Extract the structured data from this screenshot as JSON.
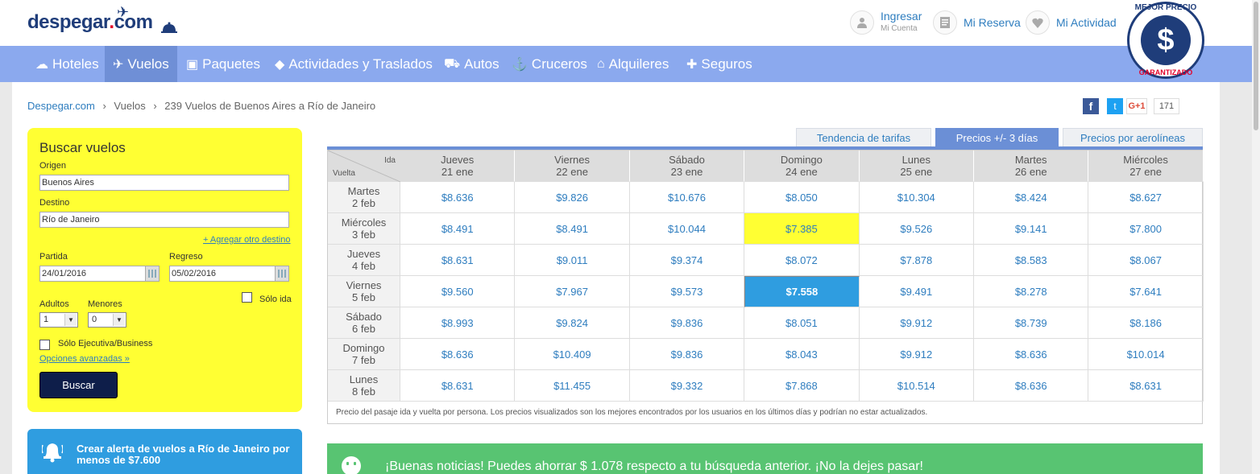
{
  "header": {
    "logo_text": "despegar",
    "logo_dot": ".",
    "logo_com": "com",
    "ingresar": "Ingresar",
    "mi_cuenta": "Mi Cuenta",
    "mi_reserva": "Mi Reserva",
    "mi_actividad": "Mi Actividad",
    "badge_top": "MEJOR PRECIO",
    "badge_symbol": "$",
    "badge_bottom": "GARANTIZADO"
  },
  "nav": [
    {
      "label": "Hoteles",
      "icon": "bed-icon"
    },
    {
      "label": "Vuelos",
      "icon": "plane-icon",
      "active": true
    },
    {
      "label": "Paquetes",
      "icon": "suitcase-icon"
    },
    {
      "label": "Actividades y Traslados",
      "icon": "ticket-icon"
    },
    {
      "label": "Autos",
      "icon": "car-icon"
    },
    {
      "label": "Cruceros",
      "icon": "ship-icon"
    },
    {
      "label": "Alquileres",
      "icon": "house-icon"
    },
    {
      "label": "Seguros",
      "icon": "medkit-icon"
    }
  ],
  "breadcrumb": {
    "home": "Despegar.com",
    "sep": "›",
    "section": "Vuelos",
    "current": "239 Vuelos de Buenos Aires a Río de Janeiro"
  },
  "social": {
    "fb": "f",
    "tw": "t",
    "gplus": "G+1",
    "count": "171"
  },
  "search": {
    "title": "Buscar vuelos",
    "origen_label": "Origen",
    "origen_value": "Buenos Aires",
    "destino_label": "Destino",
    "destino_value": "Río de Janeiro",
    "add_dest": "+ Agregar otro destino",
    "partida_label": "Partida",
    "partida_value": "24/01/2016",
    "regreso_label": "Regreso",
    "regreso_value": "05/02/2016",
    "solo_ida": "Sólo ida",
    "adultos_label": "Adultos",
    "adultos_value": "1",
    "menores_label": "Menores",
    "menores_value": "0",
    "ejecutiva": "Sólo Ejecutiva/Business",
    "avanzadas": "Opciones avanzadas »",
    "buscar": "Buscar"
  },
  "alert": {
    "text": "Crear alerta de vuelos a Río de Janeiro por menos de $7.600"
  },
  "tabs": [
    {
      "label": "Tendencia de tarifas"
    },
    {
      "label": "Precios +/- 3 días",
      "active": true
    },
    {
      "label": "Precios por aerolíneas"
    }
  ],
  "matrix": {
    "ida_label": "Ida",
    "vuelta_label": "Vuelta",
    "columns": [
      {
        "day": "Jueves",
        "date": "21 ene"
      },
      {
        "day": "Viernes",
        "date": "22 ene"
      },
      {
        "day": "Sábado",
        "date": "23 ene"
      },
      {
        "day": "Domingo",
        "date": "24 ene"
      },
      {
        "day": "Lunes",
        "date": "25 ene"
      },
      {
        "day": "Martes",
        "date": "26 ene"
      },
      {
        "day": "Miércoles",
        "date": "27 ene"
      }
    ],
    "rows": [
      {
        "day": "Martes",
        "date": "2 feb",
        "prices": [
          "$8.636",
          "$9.826",
          "$10.676",
          "$8.050",
          "$10.304",
          "$8.424",
          "$8.627"
        ]
      },
      {
        "day": "Miércoles",
        "date": "3 feb",
        "prices": [
          "$8.491",
          "$8.491",
          "$10.044",
          "$7.385",
          "$9.526",
          "$9.141",
          "$7.800"
        ]
      },
      {
        "day": "Jueves",
        "date": "4 feb",
        "prices": [
          "$8.631",
          "$9.011",
          "$9.374",
          "$8.072",
          "$7.878",
          "$8.583",
          "$8.067"
        ]
      },
      {
        "day": "Viernes",
        "date": "5 feb",
        "prices": [
          "$9.560",
          "$7.967",
          "$9.573",
          "$7.558",
          "$9.491",
          "$8.278",
          "$7.641"
        ]
      },
      {
        "day": "Sábado",
        "date": "6 feb",
        "prices": [
          "$8.993",
          "$9.824",
          "$9.836",
          "$8.051",
          "$9.912",
          "$8.739",
          "$8.186"
        ]
      },
      {
        "day": "Domingo",
        "date": "7 feb",
        "prices": [
          "$8.636",
          "$10.409",
          "$9.836",
          "$8.043",
          "$9.912",
          "$8.636",
          "$10.014"
        ]
      },
      {
        "day": "Lunes",
        "date": "8 feb",
        "prices": [
          "$8.631",
          "$11.455",
          "$9.332",
          "$7.868",
          "$10.514",
          "$8.636",
          "$8.631"
        ]
      }
    ],
    "note": "Precio del pasaje ida y vuelta por persona. Los precios visualizados son los mejores encontrados por los usuarios en los últimos días y podrían no estar actualizados."
  },
  "good_news": {
    "text": "¡Buenas noticias! Puedes ahorrar $ 1.078 respecto a tu búsqueda anterior. ¡No la dejes pasar!"
  },
  "colors": {
    "nav_bg": "#8ba9ee",
    "search_bg": "#ffff33",
    "link": "#2e7dbf",
    "selected_cell": "#2f9de0",
    "good_news_bg": "#58c472"
  }
}
